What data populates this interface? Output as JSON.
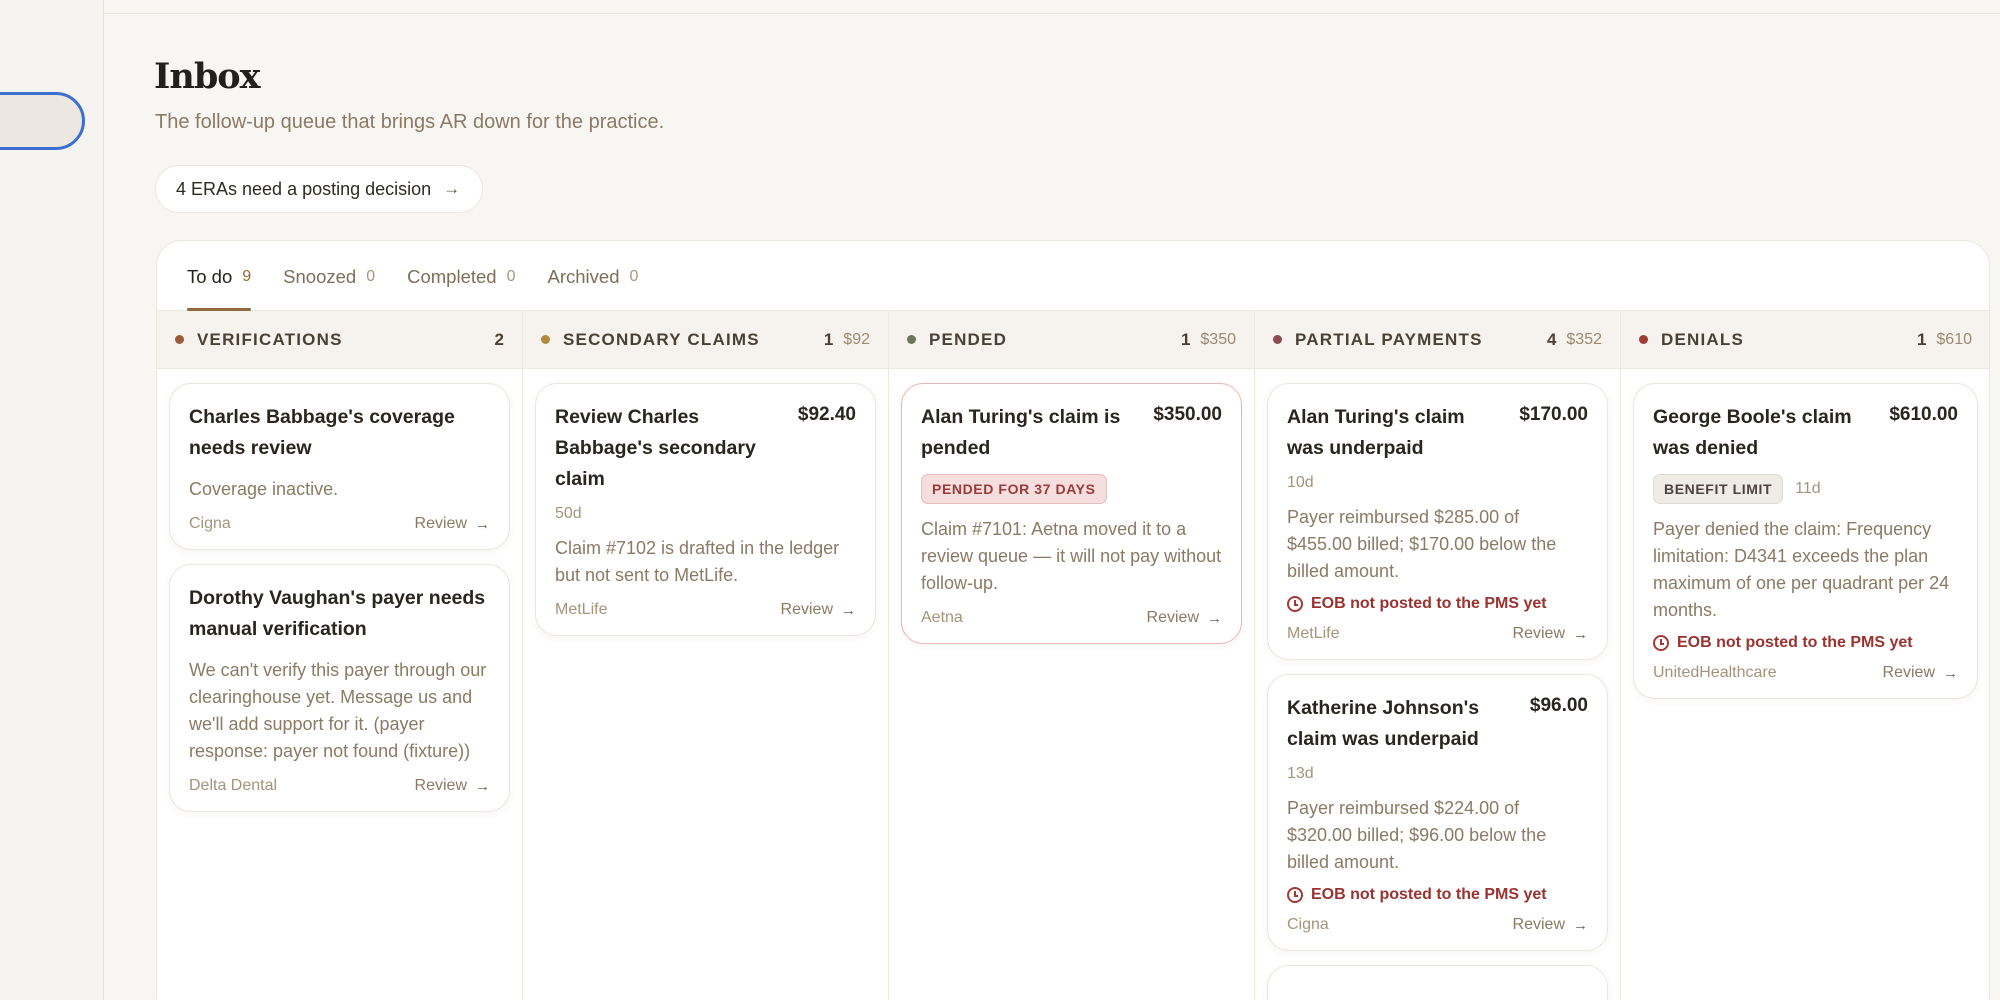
{
  "page": {
    "title": "Inbox",
    "subtitle": "The follow-up queue that brings AR down for the practice."
  },
  "alert_chip": {
    "label": "4 ERAs need a posting decision"
  },
  "tabs": [
    {
      "label": "To do",
      "count": "9"
    },
    {
      "label": "Snoozed",
      "count": "0"
    },
    {
      "label": "Completed",
      "count": "0"
    },
    {
      "label": "Archived",
      "count": "0"
    }
  ],
  "columns": [
    {
      "name": "VERIFICATIONS",
      "count": "2",
      "amount": "",
      "dot_color": "#9b5a3c",
      "cards": [
        {
          "title": "Charles Babbage's coverage needs review",
          "amount": "",
          "age": "",
          "badge": "",
          "desc": "Coverage inactive.",
          "warning": "",
          "payer": "Cigna",
          "review": "Review"
        },
        {
          "title": "Dorothy Vaughan's payer needs manual verification",
          "amount": "",
          "age": "",
          "badge": "",
          "desc": "We can't verify this payer through our clearinghouse yet. Message us and we'll add support for it. (payer response: payer not found (fixture))",
          "warning": "",
          "payer": "Delta Dental",
          "review": "Review"
        }
      ]
    },
    {
      "name": "SECONDARY CLAIMS",
      "count": "1",
      "amount": "$92",
      "dot_color": "#b08a3e",
      "cards": [
        {
          "title": "Review Charles Babbage's secondary claim",
          "amount": "$92.40",
          "age": "50d",
          "badge": "",
          "desc": "Claim #7102 is drafted in the ledger but not sent to MetLife.",
          "warning": "",
          "payer": "MetLife",
          "review": "Review"
        }
      ]
    },
    {
      "name": "PENDED",
      "count": "1",
      "amount": "$350",
      "dot_color": "#6f7558",
      "cards": [
        {
          "title": "Alan Turing's claim is pended",
          "amount": "$350.00",
          "age": "",
          "badge": "PENDED FOR 37 DAYS",
          "desc": "Claim #7101: Aetna moved it to a review queue — it will not pay without follow-up.",
          "warning": "",
          "payer": "Aetna",
          "review": "Review"
        }
      ]
    },
    {
      "name": "PARTIAL PAYMENTS",
      "count": "4",
      "amount": "$352",
      "dot_color": "#8a4a4e",
      "cards": [
        {
          "title": "Alan Turing's claim was underpaid",
          "amount": "$170.00",
          "age": "10d",
          "badge": "",
          "desc": "Payer reimbursed $285.00 of $455.00 billed; $170.00 below the billed amount.",
          "warning": "EOB not posted to the PMS yet",
          "payer": "MetLife",
          "review": "Review"
        },
        {
          "title": "Katherine Johnson's claim was underpaid",
          "amount": "$96.00",
          "age": "13d",
          "badge": "",
          "desc": "Payer reimbursed $224.00 of $320.00 billed; $96.00 below the billed amount.",
          "warning": "EOB not posted to the PMS yet",
          "payer": "Cigna",
          "review": "Review"
        }
      ]
    },
    {
      "name": "DENIALS",
      "count": "1",
      "amount": "$610",
      "dot_color": "#a23a36",
      "cards": [
        {
          "title": "George Boole's claim was denied",
          "amount": "$610.00",
          "age": "11d",
          "badge": "BENEFIT LIMIT",
          "desc": "Payer denied the claim: Frequency limitation: D4341 exceeds the plan maximum of one per quadrant per 24 months.",
          "warning": "EOB not posted to the PMS yet",
          "payer": "UnitedHealthcare",
          "review": "Review"
        }
      ]
    }
  ]
}
